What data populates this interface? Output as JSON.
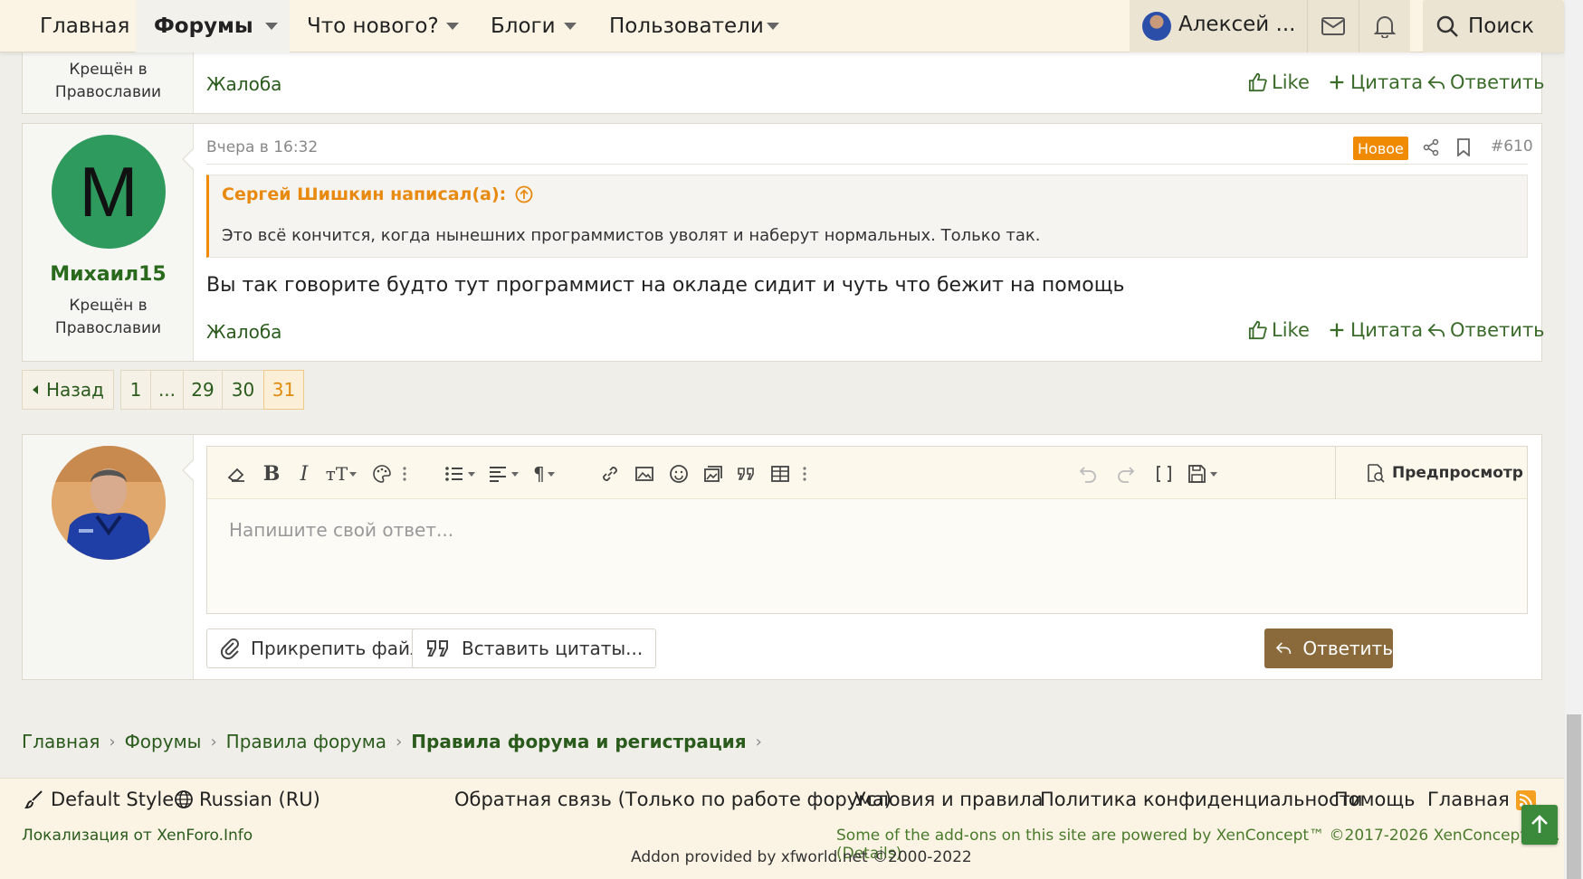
{
  "nav": {
    "tabs": [
      {
        "label": "Главная"
      },
      {
        "label": "Форумы"
      },
      {
        "label": "Что нового?"
      },
      {
        "label": "Блоги"
      },
      {
        "label": "Пользователи"
      }
    ],
    "user_name": "Алексей ...",
    "search_label": "Поиск"
  },
  "prev_post": {
    "user_title_line1": "Крещён в",
    "user_title_line2": "Православии",
    "report": "Жалоба",
    "like": "Like",
    "quote": "Цитата",
    "reply": "Ответить"
  },
  "post": {
    "avatar_letter": "M",
    "avatar_color": "#2f9a5e",
    "username": "Михаил15",
    "user_title_line1": "Крещён в",
    "user_title_line2": "Православии",
    "date": "Вчера в 16:32",
    "new_badge": "Новое",
    "number": "#610",
    "quote_author": "Сергей Шишкин написал(а):",
    "quote_text": "Это всё кончится, когда нынешних программистов уволят и наберут нормальных. Только так.",
    "text": "Вы так говорите будто тут программист на окладе сидит и чуть что бежит на помощь",
    "report": "Жалоба",
    "like": "Like",
    "quote": "Цитата",
    "reply": "Ответить"
  },
  "pagination": {
    "back": "Назад",
    "pages": [
      "1",
      "...",
      "29",
      "30",
      "31"
    ],
    "current": "31"
  },
  "editor": {
    "preview": "Предпросмотр",
    "placeholder": "Напишите свой ответ...",
    "attach": "Прикрепить файлы",
    "insert_quotes": "Вставить цитаты...",
    "submit": "Ответить"
  },
  "breadcrumbs": [
    "Главная",
    "Форумы",
    "Правила форума",
    "Правила форума и регистрация"
  ],
  "footer": {
    "style": "Default Style",
    "language": "Russian (RU)",
    "links": [
      "Обратная связь (Только по работе форума)",
      "Условия и правила",
      "Политика конфиденциальности",
      "Помощь",
      "Главная"
    ],
    "localization": "Локализация от XenForo.Info",
    "addons": "Some of the add-ons on this site are powered by XenConcept™ ©2017-2026 XenConcept Ltd. (Details)",
    "addon_provided": "Addon provided by xfworld.net ©2000-2022"
  },
  "colors": {
    "accent_orange": "#f08a00",
    "link_green": "#2a5a1c",
    "button_brown": "#8a6a3a",
    "nav_bg": "#fbf4e4"
  }
}
